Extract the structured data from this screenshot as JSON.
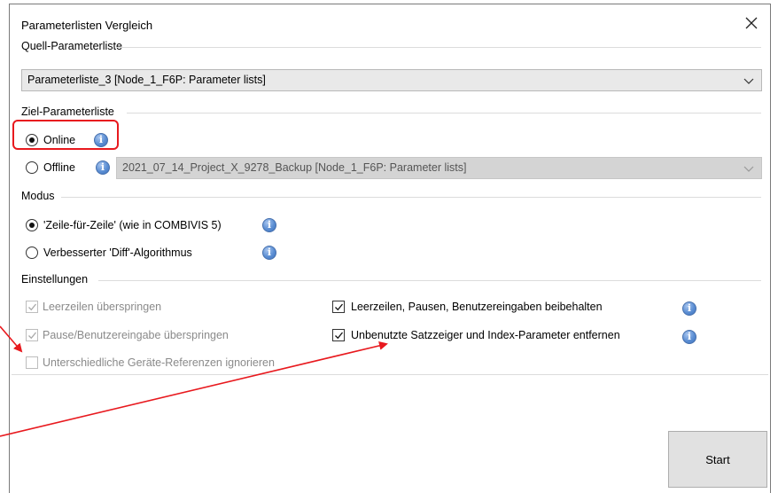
{
  "dialog": {
    "title": "Parameterlisten Vergleich"
  },
  "source": {
    "group_label": "Quell-Parameterliste",
    "selected": "Parameterliste_3 [Node_1_F6P: Parameter lists]"
  },
  "target": {
    "group_label": "Ziel-Parameterliste",
    "online_label": "Online",
    "offline_label": "Offline",
    "offline_selected": "2021_07_14_Project_X_9278_Backup [Node_1_F6P: Parameter lists]",
    "selected_mode": "Online"
  },
  "mode": {
    "group_label": "Modus",
    "option_line_by_line": "'Zeile-für-Zeile' (wie in COMBIVIS 5)",
    "option_diff": "Verbesserter 'Diff'-Algorithmus",
    "selected": "'Zeile-für-Zeile' (wie in COMBIVIS 5)"
  },
  "settings": {
    "group_label": "Einstellungen",
    "skip_empty_lines": {
      "label": "Leerzeilen überspringen",
      "checked": true,
      "enabled": false
    },
    "skip_pause_input": {
      "label": "Pause/Benutzereingabe überspringen",
      "checked": true,
      "enabled": false
    },
    "ignore_device_refs": {
      "label": "Unterschiedliche Geräte-Referenzen ignorieren",
      "checked": false,
      "enabled": false
    },
    "keep_empty_lines": {
      "label": "Leerzeilen, Pausen, Benutzereingaben beibehalten",
      "checked": true,
      "enabled": true
    },
    "remove_unused": {
      "label": "Unbenutzte Satzzeiger und Index-Parameter entfernen",
      "checked": true,
      "enabled": true
    }
  },
  "buttons": {
    "start": "Start"
  },
  "colors": {
    "annotation_red": "#e8191e",
    "info_blue": "#5b8ed3",
    "button_face": "#e1e1e1"
  }
}
